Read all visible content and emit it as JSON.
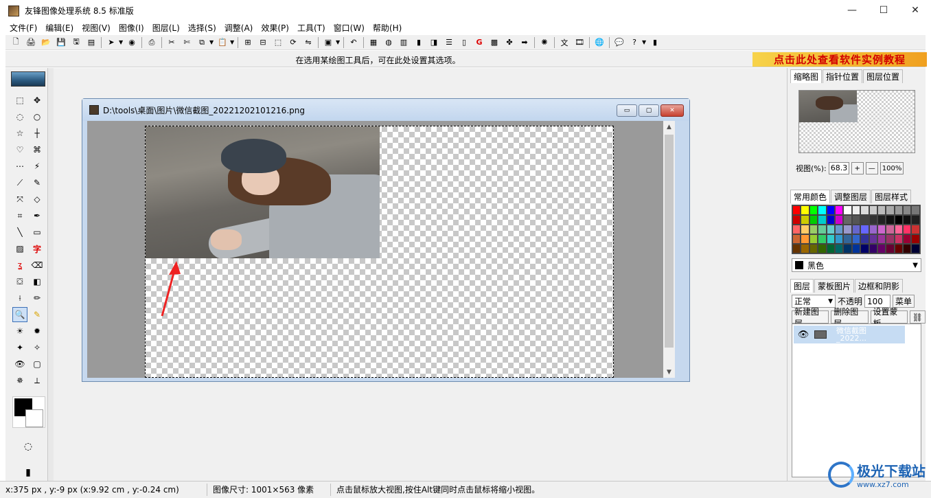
{
  "app": {
    "title": "友锋图像处理系统 8.5 标准版",
    "window_controls": [
      "—",
      "☐",
      "✕"
    ]
  },
  "menu": [
    "文件(F)",
    "编辑(E)",
    "视图(V)",
    "图像(I)",
    "图层(L)",
    "选择(S)",
    "调整(A)",
    "效果(P)",
    "工具(T)",
    "窗口(W)",
    "帮助(H)"
  ],
  "hint_bar": {
    "text": "在选用某绘图工具后，可在此处设置其选项。",
    "promo": "点击此处查看软件实例教程"
  },
  "document": {
    "title": "D:\\tools\\桌面\\图片\\微信截图_20221202101216.png",
    "buttons": [
      "▭",
      "▢",
      "✕"
    ]
  },
  "right_panel": {
    "tabs1": [
      "缩略图",
      "指针位置",
      "图层位置"
    ],
    "zoom_label": "视图(%):",
    "zoom_value": "68.3",
    "zoom_plus": "+",
    "zoom_minus": "—",
    "zoom_100": "100%",
    "tabs2": [
      "常用颜色",
      "调整图层",
      "图层样式"
    ],
    "selected_color": "黑色",
    "tabs3": [
      "图层",
      "蒙板图片",
      "边框和阴影"
    ],
    "blend_mode": "正常",
    "opacity_label": "不透明",
    "opacity_value": "100",
    "menu_button": "菜单",
    "new_layer": "新建图层",
    "delete_layer": "删除图层",
    "set_mask": "设置蒙板",
    "layer_name_1": "微信截图",
    "layer_name_2": "_2022..."
  },
  "palette": [
    "#ff0000",
    "#ffff00",
    "#00ff00",
    "#00ffff",
    "#0000ff",
    "#ff00ff",
    "#ffffff",
    "#eeeeee",
    "#dddddd",
    "#cccccc",
    "#bbbbbb",
    "#aaaaaa",
    "#999999",
    "#888888",
    "#777777",
    "#cc0000",
    "#cccc00",
    "#00cc00",
    "#00cccc",
    "#0000cc",
    "#cc00cc",
    "#666666",
    "#555555",
    "#444444",
    "#333333",
    "#222222",
    "#111111",
    "#000000",
    "#101010",
    "#202020",
    "#ff6666",
    "#ffcc66",
    "#99cc66",
    "#66cc99",
    "#66cccc",
    "#6699cc",
    "#9999cc",
    "#6666cc",
    "#6666ff",
    "#9966cc",
    "#cc66cc",
    "#cc6699",
    "#ff6699",
    "#ff3366",
    "#cc3333",
    "#cc6633",
    "#ff9933",
    "#99cc33",
    "#33cc66",
    "#33cccc",
    "#3399cc",
    "#336699",
    "#3366cc",
    "#333399",
    "#663399",
    "#993399",
    "#993366",
    "#cc3366",
    "#990033",
    "#990000",
    "#663300",
    "#996600",
    "#666600",
    "#336600",
    "#006633",
    "#006666",
    "#003366",
    "#003399",
    "#000066",
    "#330066",
    "#660066",
    "#660033",
    "#660000",
    "#330000",
    "#000033"
  ],
  "status": {
    "coords": "x:375 px , y:-9 px (x:9.92 cm , y:-0.24 cm)",
    "image_size": "图像尺寸: 1001×563 像素",
    "tip": "点击鼠标放大视图,按住Alt键同时点击鼠标将缩小视图。"
  },
  "watermark": {
    "main": "极光下载站",
    "sub": "www.xz7.com"
  }
}
